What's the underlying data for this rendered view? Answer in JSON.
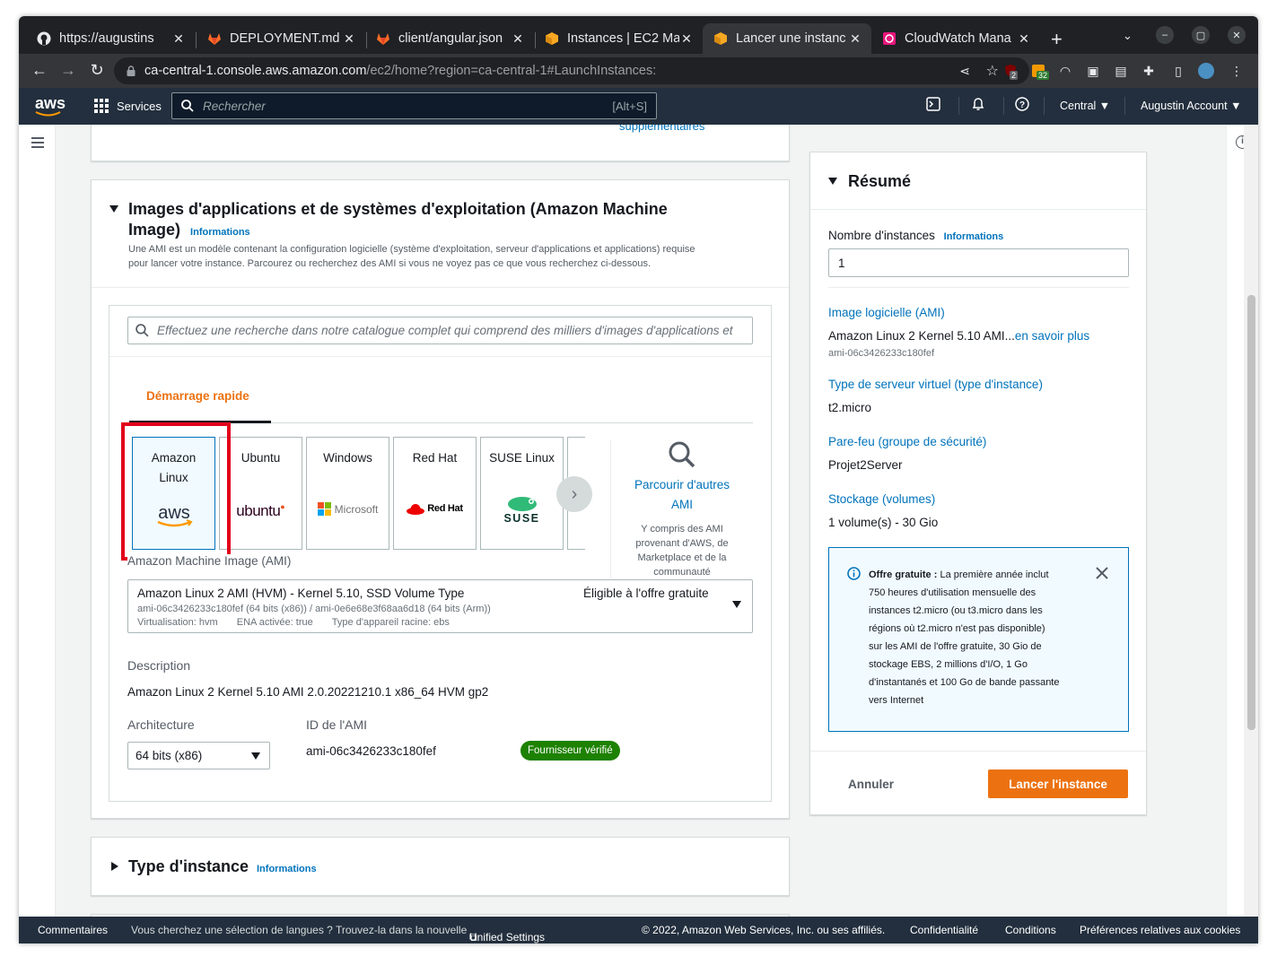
{
  "browser": {
    "tabs": [
      {
        "title": "https://augustins",
        "icon": "github-icon"
      },
      {
        "title": "DEPLOYMENT.md",
        "icon": "gitlab-icon"
      },
      {
        "title": "client/angular.json",
        "icon": "gitlab-icon"
      },
      {
        "title": "Instances | EC2 Ma",
        "icon": "aws-box-icon"
      },
      {
        "title": "Lancer une instanc",
        "icon": "aws-box-icon"
      },
      {
        "title": "CloudWatch Mana",
        "icon": "cloudwatch-icon"
      }
    ],
    "url_host": "ca-central-1.console.aws.amazon.com",
    "url_path": "/ec2/home?region=ca-central-1#LaunchInstances:",
    "extension_badges": [
      "2",
      "32"
    ]
  },
  "aws_nav": {
    "logo": "aws",
    "services": "Services",
    "search_placeholder": "Rechercher",
    "search_shortcut": "[Alt+S]",
    "region": "Central",
    "account": "Augustin Account"
  },
  "prev_section": {
    "link_fragment": "supplémentaires"
  },
  "ami_section": {
    "title_line1": "Images d'applications et de systèmes d'exploitation (Amazon Machine",
    "title_line2": "Image)",
    "info": "Informations",
    "desc_line1": "Une AMI est un modèle contenant la configuration logicielle (système d'exploitation, serveur d'applications et applications) requise",
    "desc_line2": "pour lancer votre instance. Parcourez ou recherchez des AMI si vous ne voyez pas ce que vous recherchez ci-dessous.",
    "search_placeholder": "Effectuez une recherche dans notre catalogue complet qui comprend des milliers d'images d'applications et",
    "tab_label": "Démarrage rapide",
    "cards": [
      {
        "line1": "Amazon",
        "line2": "Linux",
        "logo": "aws"
      },
      {
        "line1": "Ubuntu",
        "line2": "",
        "logo": "ubuntu"
      },
      {
        "line1": "Windows",
        "line2": "",
        "logo": "Microsoft"
      },
      {
        "line1": "Red Hat",
        "line2": "",
        "logo": "Red Hat"
      },
      {
        "line1": "SUSE Linux",
        "line2": "",
        "logo": "SUSE"
      }
    ],
    "browse_line1": "Parcourir d'autres",
    "browse_line2": "AMI",
    "browse_note": [
      "Y compris des AMI",
      "provenant d'AWS, de",
      "Marketplace et de la",
      "communauté"
    ],
    "ami_label": "Amazon Machine Image (AMI)",
    "ami_name": "Amazon Linux 2 AMI (HVM) - Kernel 5.10, SSD Volume Type",
    "ami_free_tier": "Éligible à l'offre gratuite",
    "ami_ids": "ami-06c3426233c180fef (64 bits (x86)) / ami-0e6e68e3f68aa6d18 (64 bits (Arm))",
    "ami_virt": "Virtualisation: hvm",
    "ami_ena": "ENA activée: true",
    "ami_root": "Type d'appareil racine: ebs",
    "description_label": "Description",
    "description_value": "Amazon Linux 2 Kernel 5.10 AMI 2.0.20221210.1 x86_64 HVM gp2",
    "arch_label": "Architecture",
    "arch_value": "64 bits (x86)",
    "ami_id_label": "ID de l'AMI",
    "ami_id_value": "ami-06c3426233c180fef",
    "verified_badge": "Fournisseur vérifié"
  },
  "instance_type_section": {
    "title": "Type d'instance",
    "info": "Informations"
  },
  "summary": {
    "title": "Résumé",
    "count_label": "Nombre d'instances",
    "count_info": "Informations",
    "count_value": "1",
    "ami_link": "Image logicielle (AMI)",
    "ami_value": "Amazon Linux 2 Kernel 5.10 AMI...",
    "ami_learn_more": "en savoir plus",
    "ami_id": "ami-06c3426233c180fef",
    "type_link": "Type de serveur virtuel (type d'instance)",
    "type_value": "t2.micro",
    "firewall_link": "Pare-feu (groupe de sécurité)",
    "firewall_value": "Projet2Server",
    "storage_link": "Stockage (volumes)",
    "storage_value": "1 volume(s) - 30 Gio",
    "free_tier_title": "Offre gratuite :",
    "free_tier_lines": [
      "La première année inclut",
      "750 heures d'utilisation mensuelle des",
      "instances t2.micro (ou t3.micro dans les",
      "régions où t2.micro n'est pas disponible)",
      "sur les AMI de l'offre gratuite, 30 Gio de",
      "stockage EBS, 2 millions d'I/O, 1 Go",
      "d'instantanés et 100 Go de bande passante",
      "vers Internet"
    ],
    "cancel": "Annuler",
    "launch": "Lancer l'instance"
  },
  "footer": {
    "feedback": "Commentaires",
    "language_text": "Vous cherchez une sélection de langues ? Trouvez-la dans la nouvelle",
    "unified_settings": "Unified Settings",
    "copyright": "© 2022, Amazon Web Services, Inc. ou ses affiliés.",
    "privacy": "Confidentialité",
    "terms": "Conditions",
    "cookies": "Préférences relatives aux cookies"
  },
  "colors": {
    "chrome_dark": "#202124",
    "aws_nav": "#232f3e",
    "aws_orange": "#ec7211",
    "aws_link": "#0073bb",
    "highlight_red": "#e3001b",
    "verified_green": "#1d8102"
  }
}
